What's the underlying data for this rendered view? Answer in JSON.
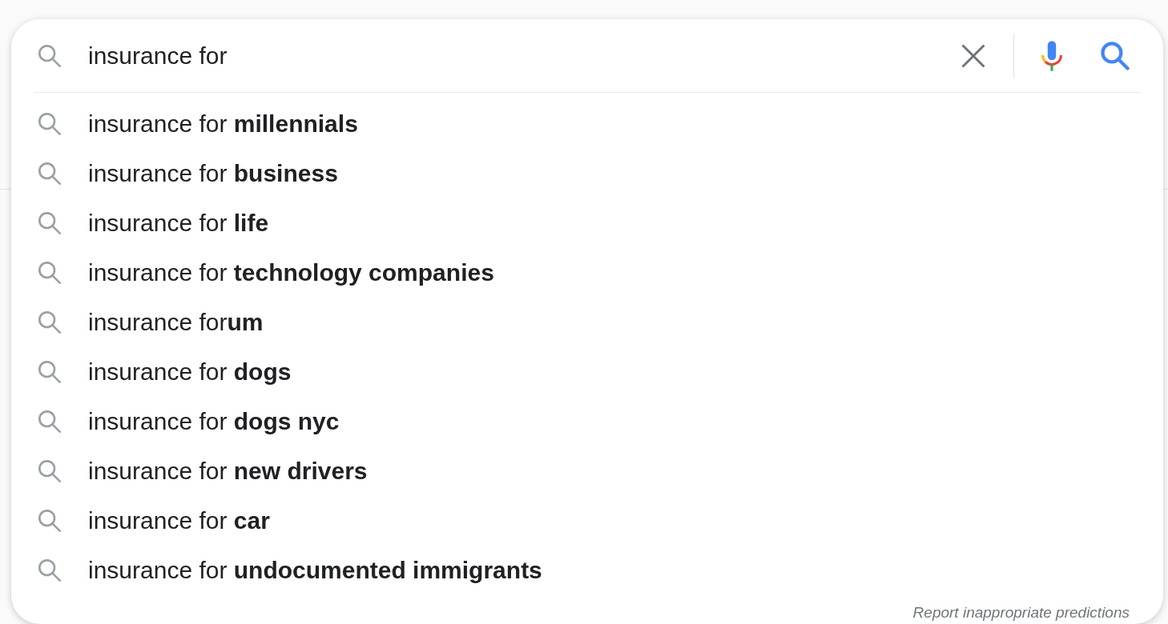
{
  "search_box": {
    "value": "insurance for"
  },
  "suggestions": [
    {
      "text": "insurance for **millennials**"
    },
    {
      "text": "insurance for **business**"
    },
    {
      "text": "insurance for **life**"
    },
    {
      "text": "insurance for **technology companies**"
    },
    {
      "text": "insurance for**um**"
    },
    {
      "text": "insurance for **dogs**"
    },
    {
      "text": "insurance for **dogs nyc**"
    },
    {
      "text": "insurance for **new drivers**"
    },
    {
      "text": "insurance for **car**"
    },
    {
      "text": "insurance for **undocumented immigrants**"
    }
  ],
  "footer": {
    "report_link": "Report inappropriate predictions"
  }
}
